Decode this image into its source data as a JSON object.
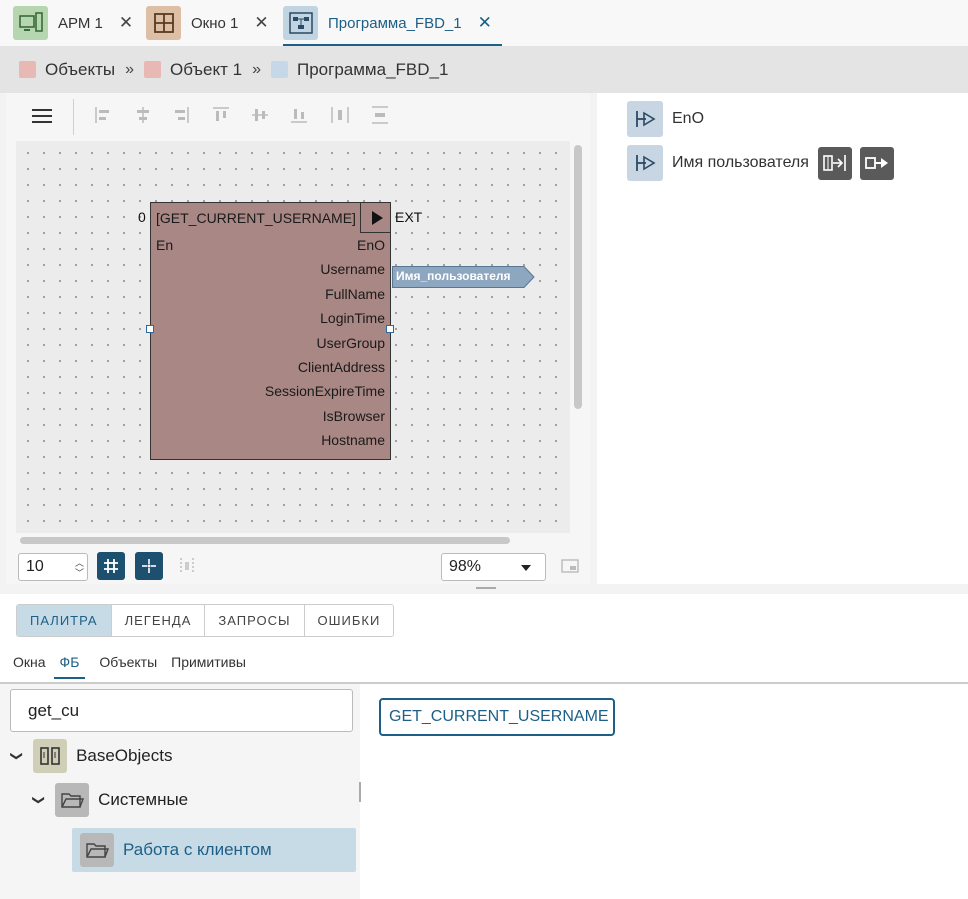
{
  "tabs": [
    {
      "label": "АРМ 1",
      "icon": "workstation-icon",
      "color": "#b6d6b0"
    },
    {
      "label": "Окно 1",
      "icon": "window-grid-icon",
      "color": "#dcbfa4"
    },
    {
      "label": "Программа_FBD_1",
      "icon": "fbd-program-icon",
      "color": "#c0d4e2"
    }
  ],
  "breadcrumb": [
    {
      "label": "Объекты",
      "color": "#e8b8b4"
    },
    {
      "label": "Объект 1",
      "color": "#e8b8b4"
    },
    {
      "label": "Программа_FBD_1",
      "color": "#c6d8e8"
    }
  ],
  "breadcrumb_sep": "»",
  "fb_block": {
    "title": "[GET_CURRENT_USERNAME]",
    "index": "0",
    "ext_label": "EXT",
    "inputs": [
      "En"
    ],
    "outputs": [
      "EnO",
      "Username",
      "FullName",
      "LoginTime",
      "UserGroup",
      "ClientAddress",
      "SessionExpireTime",
      "IsBrowser",
      "Hostname"
    ],
    "color": "#a88784"
  },
  "output_tag": "Имя_пользователя",
  "canvas_controls": {
    "grid_step": "10",
    "zoom": "98%"
  },
  "right_panel": {
    "items": [
      {
        "label": "EnO"
      },
      {
        "label": "Имя пользователя"
      }
    ]
  },
  "bottom": {
    "panel_tabs": [
      "ПАЛИТРА",
      "ЛЕГЕНДА",
      "ЗАПРОСЫ",
      "ОШИБКИ"
    ],
    "sub_tabs": [
      "Окна",
      "ФБ",
      "Объекты",
      "Примитивы"
    ],
    "search_value": "get_cu",
    "tree": [
      {
        "label": "BaseObjects"
      },
      {
        "label": "Системные"
      },
      {
        "label": "Работа с клиентом"
      }
    ],
    "result": "GET_CURRENT_USERNAME"
  },
  "colors": {
    "accent": "#1d5f86",
    "selected_bg": "#c7dbe7"
  }
}
